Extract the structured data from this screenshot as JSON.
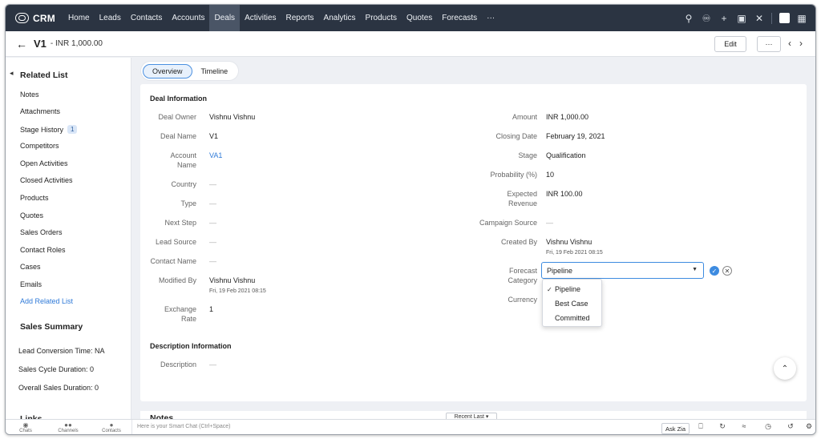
{
  "app": {
    "brand": "CRM"
  },
  "nav": {
    "items": [
      "Home",
      "Leads",
      "Contacts",
      "Accounts",
      "Deals",
      "Activities",
      "Reports",
      "Analytics",
      "Products",
      "Quotes",
      "Forecasts",
      "···"
    ],
    "active": "Deals",
    "icons": [
      "search-icon",
      "bell-icon",
      "plus-icon",
      "calendar-icon",
      "tools-icon",
      "app-icon",
      "grid-icon"
    ]
  },
  "record": {
    "title": "V1",
    "subtitle": "- INR 1,000.00",
    "edit_label": "Edit",
    "more_label": "···"
  },
  "sidebar": {
    "heading": "Related List",
    "items": [
      {
        "label": "Notes"
      },
      {
        "label": "Attachments"
      },
      {
        "label": "Stage History",
        "badge": "1"
      },
      {
        "label": "Competitors"
      },
      {
        "label": "Open Activities"
      },
      {
        "label": "Closed Activities"
      },
      {
        "label": "Products"
      },
      {
        "label": "Quotes"
      },
      {
        "label": "Sales Orders"
      },
      {
        "label": "Contact Roles"
      },
      {
        "label": "Cases"
      },
      {
        "label": "Emails"
      }
    ],
    "add_link": "Add Related List",
    "summary_heading": "Sales Summary",
    "stats": [
      "Lead Conversion Time: NA",
      "Sales Cycle Duration: 0",
      "Overall Sales Duration: 0"
    ],
    "links_heading": "Links"
  },
  "tabs": [
    "Overview",
    "Timeline"
  ],
  "deal_info": {
    "title": "Deal Information",
    "left": [
      {
        "label": "Deal Owner",
        "value": "Vishnu Vishnu"
      },
      {
        "label": "Deal Name",
        "value": "V1"
      },
      {
        "label": "Account Name",
        "value": "VA1"
      },
      {
        "label": "Country",
        "value": "—"
      },
      {
        "label": "Type",
        "value": "—"
      },
      {
        "label": "Next Step",
        "value": "—"
      },
      {
        "label": "Lead Source",
        "value": "—"
      },
      {
        "label": "Contact Name",
        "value": "—"
      },
      {
        "label": "Modified By",
        "value": "Vishnu Vishnu",
        "sub": "Fri, 19 Feb 2021 08:15"
      },
      {
        "label": "Exchange Rate",
        "value": "1"
      }
    ],
    "right": [
      {
        "label": "Amount",
        "value": "INR 1,000.00"
      },
      {
        "label": "Closing Date",
        "value": "February 19, 2021"
      },
      {
        "label": "Stage",
        "value": "Qualification"
      },
      {
        "label": "Probability (%)",
        "value": "10"
      },
      {
        "label": "Expected Revenue",
        "value": "INR 100.00"
      },
      {
        "label": "Campaign Source",
        "value": "—"
      },
      {
        "label": "Created By",
        "value": "Vishnu Vishnu",
        "sub": "Fri, 19 Feb 2021 08:15"
      },
      {
        "label": "Forecast Category",
        "value": "Pipeline"
      },
      {
        "label": "Currency",
        "value": ""
      }
    ]
  },
  "forecast_dropdown": {
    "selected": "Pipeline",
    "options": [
      "Pipeline",
      "Best Case",
      "Committed"
    ]
  },
  "description_info": {
    "title": "Description Information",
    "label": "Description",
    "value": "—"
  },
  "notes_section": {
    "title": "Notes",
    "filter": "Recent Last ▾"
  },
  "bottom": {
    "tools": [
      "Chats",
      "Channels",
      "Contacts"
    ],
    "chat_placeholder": "Here is your Smart Chat (Ctrl+Space)",
    "ask_zia": "Ask Zia"
  },
  "colors": {
    "nav_bg": "#2b3442",
    "accent": "#3d8be0",
    "link": "#2f7ad8"
  }
}
